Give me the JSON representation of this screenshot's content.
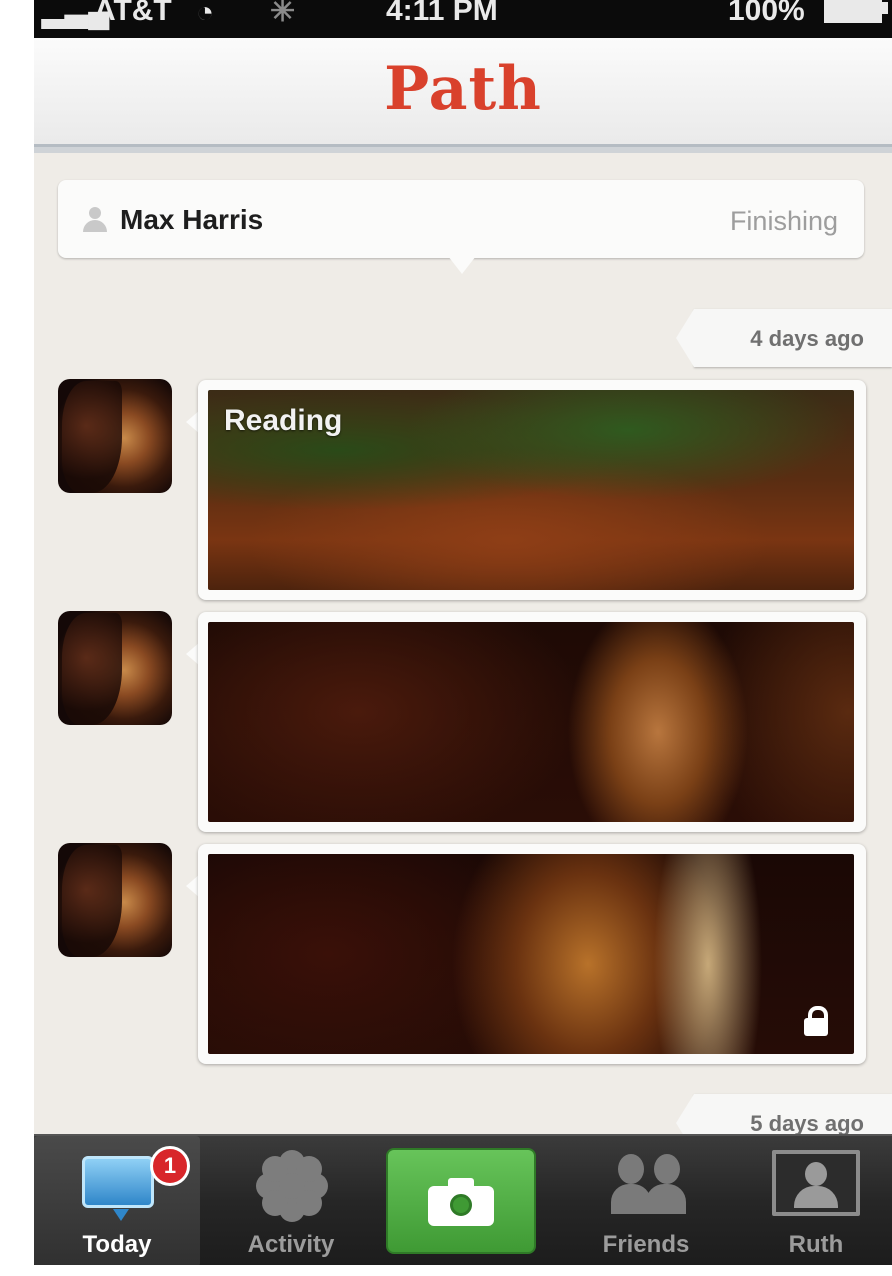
{
  "status_bar": {
    "signal": "▂▃▄",
    "carrier": "AT&T",
    "wifi": "◔",
    "activity": "✳",
    "time": "4:11 PM",
    "battery": "100%"
  },
  "nav": {
    "logo": "Path"
  },
  "profile": {
    "name": "Max Harris",
    "status": "Finishing"
  },
  "feed": {
    "date_1": "4 days ago",
    "items": [
      {
        "caption": "Reading",
        "locked": false
      },
      {
        "caption": "",
        "locked": false
      },
      {
        "caption": "",
        "locked": true
      }
    ],
    "date_2": "5 days ago"
  },
  "tab_bar": {
    "tabs": [
      {
        "label": "Today",
        "icon": "today-icon",
        "badge": "1",
        "active": true
      },
      {
        "label": "Activity",
        "icon": "activity-icon"
      },
      {
        "label": "",
        "icon": "camera-icon"
      },
      {
        "label": "Friends",
        "icon": "friends-icon"
      },
      {
        "label": "Ruth",
        "icon": "profile-icon"
      }
    ]
  },
  "colors": {
    "brand": "#d9412c",
    "camera_button": "#4fae43",
    "badge": "#d8262a",
    "background": "#efece7"
  }
}
